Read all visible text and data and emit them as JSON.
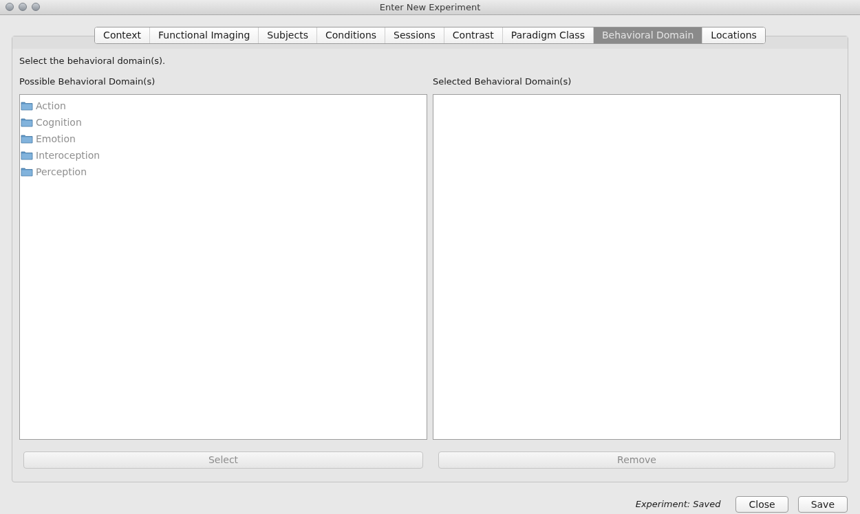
{
  "window": {
    "title": "Enter New Experiment"
  },
  "tabs": [
    {
      "label": "Context",
      "selected": false
    },
    {
      "label": "Functional Imaging",
      "selected": false
    },
    {
      "label": "Subjects",
      "selected": false
    },
    {
      "label": "Conditions",
      "selected": false
    },
    {
      "label": "Sessions",
      "selected": false
    },
    {
      "label": "Contrast",
      "selected": false
    },
    {
      "label": "Paradigm Class",
      "selected": false
    },
    {
      "label": "Behavioral Domain",
      "selected": true
    },
    {
      "label": "Locations",
      "selected": false
    }
  ],
  "instruction": "Select the behavioral domain(s).",
  "possible": {
    "label": "Possible Behavioral Domain(s)",
    "items": [
      {
        "label": "Action",
        "disabled": true
      },
      {
        "label": "Cognition",
        "disabled": true
      },
      {
        "label": "Emotion",
        "disabled": true
      },
      {
        "label": "Interoception",
        "disabled": true
      },
      {
        "label": "Perception",
        "disabled": true
      }
    ],
    "button": {
      "label": "Select",
      "disabled": true
    }
  },
  "selected_list": {
    "label": "Selected Behavioral Domain(s)",
    "button": {
      "label": "Remove",
      "disabled": true
    }
  },
  "status": "Experiment: Saved",
  "buttons": [
    "Close",
    "Save"
  ]
}
